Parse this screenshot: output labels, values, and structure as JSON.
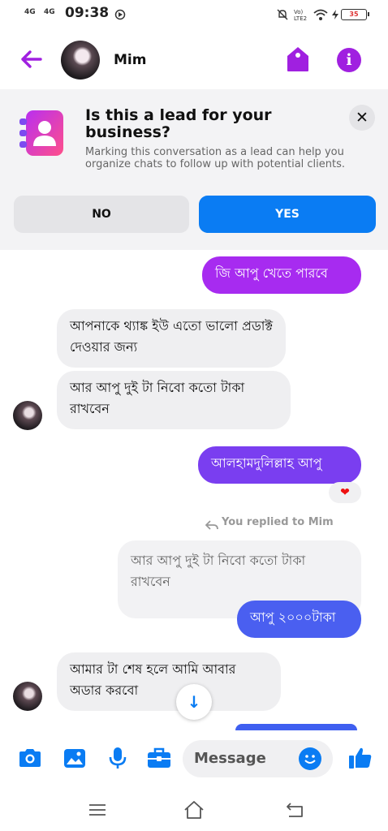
{
  "status_bar": {
    "net1": "4G",
    "net2": "4G",
    "time": "09:38",
    "battery": "35"
  },
  "header": {
    "contact_name": "Mim"
  },
  "lead_banner": {
    "title": "Is this a lead for your business?",
    "description": "Marking this conversation as a lead can help you organize chats to follow up with potential clients.",
    "no_label": "NO",
    "yes_label": "YES",
    "close_label": "✕"
  },
  "messages": {
    "m1": "জি আপু খেতে পারবে",
    "m2": "আপনাকে  থ্যাঙ্ক ইউ  এতো ভালো প্রডাক্ট  দেওয়ার জন্য",
    "m3": "আর আপু দুই টা নিবো কতো টাকা রাখবেন",
    "m4": "আলহামদুলিল্লাহ  আপু",
    "reaction": "❤",
    "replied_label": "You replied to Mim",
    "quoted": "আর আপু দুই টা নিবো কতো টাকা রাখবেন",
    "m5": "আপু ২০০০টাকা",
    "m6": "আমার টা শেষ হলে আমি আবার অডার করবো"
  },
  "composer": {
    "placeholder": "Message"
  },
  "colors": {
    "accent_purple": "#a020e0",
    "messenger_blue": "#0a7cf3",
    "bubble_gradient_top": "#a72bf0",
    "bubble_gradient_bottom": "#4a5ff0"
  },
  "icons": [
    "back-arrow-icon",
    "tag-icon",
    "info-icon",
    "contact-book-icon",
    "close-icon",
    "camera-icon",
    "gallery-icon",
    "microphone-icon",
    "briefcase-icon",
    "emoji-icon",
    "thumbs-up-icon",
    "scroll-down-icon",
    "menu-icon",
    "home-icon",
    "back-nav-icon"
  ]
}
